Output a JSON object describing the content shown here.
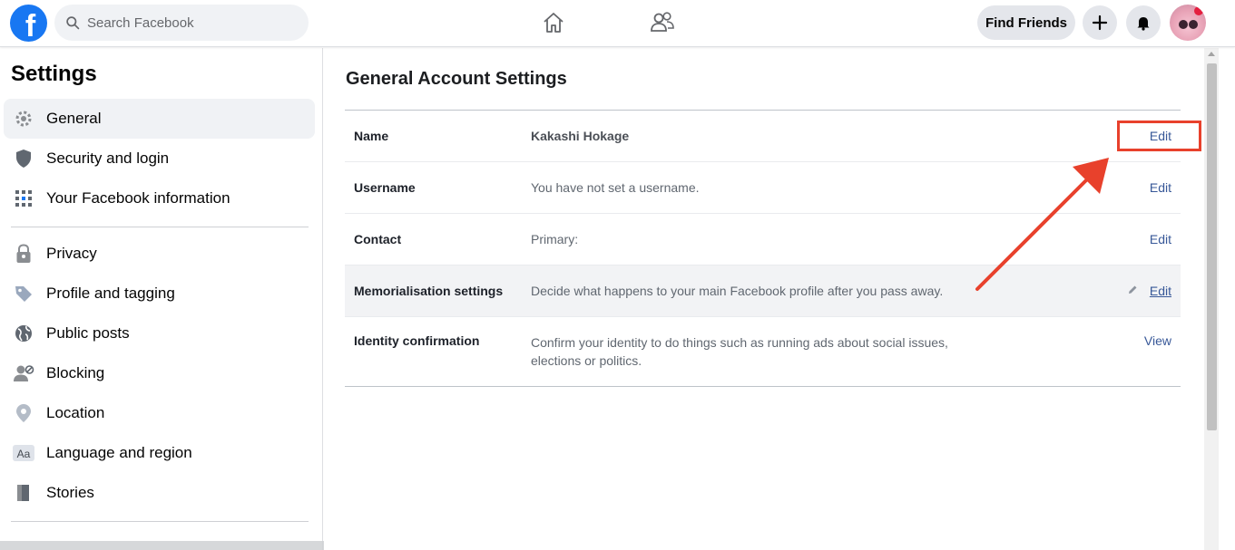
{
  "header": {
    "logo_letter": "f",
    "search_placeholder": "Search Facebook",
    "find_friends_label": "Find Friends",
    "accent": "#1877f2"
  },
  "sidebar": {
    "title": "Settings",
    "items": [
      {
        "label": "General",
        "icon": "gear-icon",
        "active": true
      },
      {
        "label": "Security and login",
        "icon": "shield-icon"
      },
      {
        "label": "Your Facebook information",
        "icon": "grid-icon"
      },
      {
        "label": "Privacy",
        "icon": "lock-icon"
      },
      {
        "label": "Profile and tagging",
        "icon": "tag-icon"
      },
      {
        "label": "Public posts",
        "icon": "globe-icon"
      },
      {
        "label": "Blocking",
        "icon": "block-user-icon"
      },
      {
        "label": "Location",
        "icon": "location-pin-icon"
      },
      {
        "label": "Language and region",
        "icon": "language-icon"
      },
      {
        "label": "Stories",
        "icon": "book-icon"
      }
    ]
  },
  "main": {
    "title": "General Account Settings",
    "rows": [
      {
        "label": "Name",
        "value": "Kakashi Hokage",
        "action": "Edit"
      },
      {
        "label": "Username",
        "value": "You have not set a username.",
        "action": "Edit"
      },
      {
        "label": "Contact",
        "value": "Primary:",
        "action": "Edit"
      },
      {
        "label": "Memorialisation settings",
        "value": "Decide what happens to your main Facebook profile after you pass away.",
        "action": "Edit"
      },
      {
        "label": "Identity confirmation",
        "value": "Confirm your identity to do things such as running ads about social issues, elections or politics.",
        "action": "View"
      }
    ]
  },
  "annotation_color": "#e8412c"
}
